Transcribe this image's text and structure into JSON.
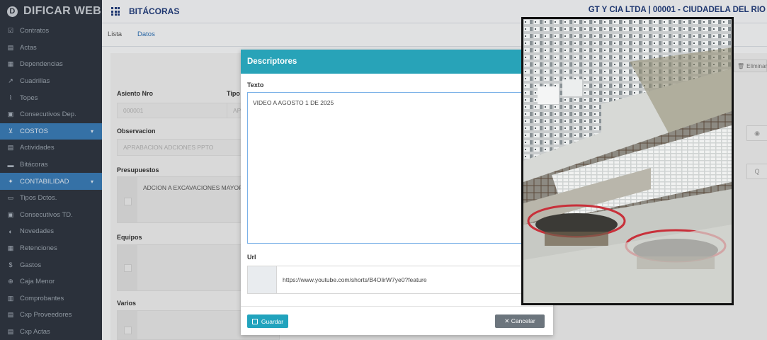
{
  "brand": {
    "name": "DIFICAR WEB",
    "logo_letter": "D"
  },
  "header": {
    "module_title": "BITÁCORAS",
    "company": "GT Y CIA LTDA  | 00001 - CIUDADELA DEL RIO"
  },
  "sidebar": {
    "items": [
      {
        "label": "Contratos",
        "icon": "check-square-icon"
      },
      {
        "label": "Actas",
        "icon": "document-icon"
      },
      {
        "label": "Dependencias",
        "icon": "building-icon"
      },
      {
        "label": "Cuadrillas",
        "icon": "tools-icon"
      },
      {
        "label": "Topes",
        "icon": "chart-line-icon"
      },
      {
        "label": "Consecutivos Dep.",
        "icon": "list-icon"
      },
      {
        "label": "COSTOS",
        "icon": "dollar-hand-icon",
        "section": true
      },
      {
        "label": "Actividades",
        "icon": "document-icon"
      },
      {
        "label": "Bitácoras",
        "icon": "book-icon"
      },
      {
        "label": "CONTABILIDAD",
        "icon": "gear-icon",
        "section": true
      },
      {
        "label": "Tipos Dctos.",
        "icon": "window-icon"
      },
      {
        "label": "Consecutivos TD.",
        "icon": "list-icon"
      },
      {
        "label": "Novedades",
        "icon": "shield-icon"
      },
      {
        "label": "Retenciones",
        "icon": "calculator-icon"
      },
      {
        "label": "Gastos",
        "icon": "dollar-icon"
      },
      {
        "label": "Caja Menor",
        "icon": "search-icon"
      },
      {
        "label": "Comprobantes",
        "icon": "keyboard-icon"
      },
      {
        "label": "Cxp Proveedores",
        "icon": "document-icon"
      },
      {
        "label": "Cxp Actas",
        "icon": "document-icon"
      }
    ]
  },
  "main": {
    "tabs": [
      "Lista",
      "Datos"
    ],
    "form": {
      "asiento_label": "Asiento Nro",
      "asiento_value": "000001",
      "tipo_label": "Tipo",
      "tipo_value": "AP",
      "observacion_label": "Observacion",
      "observacion_value": "APRABACION ADCIONES PPTO",
      "presupuestos_label": "Presupuestos",
      "presupuestos_value": "ADCION A EXCAVACIONES MAYOR C",
      "equipos_label": "Equipos",
      "varios_label": "Varios",
      "eliminar_label": "Eliminar"
    }
  },
  "modal": {
    "title": "Descriptores",
    "texto_label": "Texto",
    "texto_value": "VIDEO A AGOSTO 1 DE 2025",
    "url_label": "Url",
    "url_value": "https://www.youtube.com/shorts/B4OlirW7ye0?feature",
    "save_label": "Guardar",
    "cancel_label": "✕ Cancelar"
  },
  "colors": {
    "accent": "#28a3b8",
    "sidebar": "#2f3641",
    "section": "#3a7bb5",
    "title": "#223c7a"
  }
}
